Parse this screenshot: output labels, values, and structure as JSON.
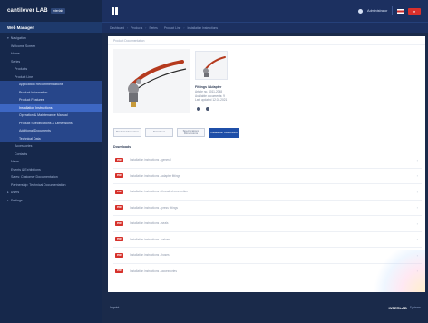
{
  "app": {
    "logo": "cantilever LAB",
    "logo_badge": "Interlab"
  },
  "sidebar": {
    "title": "Web Manager",
    "items": [
      {
        "label": "Navigation",
        "level": 0,
        "state": "normal",
        "caret": "▾"
      },
      {
        "label": "Welcome Screen",
        "level": 1,
        "state": "normal",
        "caret": ""
      },
      {
        "label": "Home",
        "level": 1,
        "state": "normal",
        "caret": ""
      },
      {
        "label": "Series",
        "level": 1,
        "state": "normal",
        "caret": ""
      },
      {
        "label": "Products",
        "level": 2,
        "state": "normal",
        "caret": ""
      },
      {
        "label": "Product Line",
        "level": 2,
        "state": "normal",
        "caret": ""
      },
      {
        "label": "Application Recommendations",
        "level": 3,
        "state": "hl",
        "caret": ""
      },
      {
        "label": "Product Information",
        "level": 3,
        "state": "hl",
        "caret": ""
      },
      {
        "label": "Product Features",
        "level": 3,
        "state": "hl",
        "caret": ""
      },
      {
        "label": "Installation Instructions",
        "level": 3,
        "state": "active",
        "caret": ""
      },
      {
        "label": "Operation & Maintenance Manual",
        "level": 3,
        "state": "hl",
        "caret": ""
      },
      {
        "label": "Product Specifications & Dimensions",
        "level": 3,
        "state": "hl",
        "caret": ""
      },
      {
        "label": "Additional Documents",
        "level": 3,
        "state": "hl",
        "caret": ""
      },
      {
        "label": "Technical Data",
        "level": 3,
        "state": "hl",
        "caret": ""
      },
      {
        "label": "Accessories",
        "level": 2,
        "state": "normal",
        "caret": ""
      },
      {
        "label": "Contacts",
        "level": 2,
        "state": "normal",
        "caret": ""
      },
      {
        "label": "News",
        "level": 1,
        "state": "normal",
        "caret": ""
      },
      {
        "label": "Events & Exhibitions",
        "level": 1,
        "state": "normal",
        "caret": ""
      },
      {
        "label": "Sales: Customer Documentation",
        "level": 1,
        "state": "normal",
        "caret": ""
      },
      {
        "label": "Partnership: Technical Documentation",
        "level": 1,
        "state": "normal",
        "caret": ""
      },
      {
        "label": "Users",
        "level": 0,
        "state": "normal",
        "caret": "▸"
      },
      {
        "label": "Settings",
        "level": 0,
        "state": "normal",
        "caret": "▸"
      }
    ]
  },
  "topbar": {
    "user": "Administrator",
    "close_label": "×"
  },
  "breadcrumb": [
    "Dashboard",
    "Products",
    "Series",
    "Product Line",
    "Installation Instructions"
  ],
  "card": {
    "header": "Product Documentation",
    "product": {
      "title": "Fittings / Adapter",
      "meta_lines": [
        "Article no. 4011-2048",
        "Available documents: 9",
        "Last updated 12.03.2021"
      ]
    },
    "buttons": [
      {
        "label": "Product Information",
        "primary": false
      },
      {
        "label": "Datasheet",
        "primary": false
      },
      {
        "label": "Specifications Dimensions",
        "primary": false
      },
      {
        "label": "Installation Instructions",
        "primary": true
      }
    ],
    "section_title": "Downloads",
    "documents": [
      {
        "badge": "PDF",
        "title": "Installation instructions - general"
      },
      {
        "badge": "PDF",
        "title": "Installation instructions - adapter fittings"
      },
      {
        "badge": "PDF",
        "title": "Installation instructions - threaded connection"
      },
      {
        "badge": "PDF",
        "title": "Installation instructions - press fittings"
      },
      {
        "badge": "PDF",
        "title": "Installation instructions - seals"
      },
      {
        "badge": "PDF",
        "title": "Installation instructions - valves"
      },
      {
        "badge": "PDF",
        "title": "Installation instructions - hoses"
      },
      {
        "badge": "PDF",
        "title": "Installation instructions - accessories"
      }
    ]
  },
  "footer": {
    "left": "Imprint",
    "brand": "INTERLAB",
    "brand_sub": "Systems"
  },
  "colors": {
    "sidebar_bg": "#16284b",
    "active_item": "#3d67c4",
    "primary_button": "#1f4fa8",
    "pdf_badge": "#d6312b",
    "close_badge": "#d9302c"
  }
}
